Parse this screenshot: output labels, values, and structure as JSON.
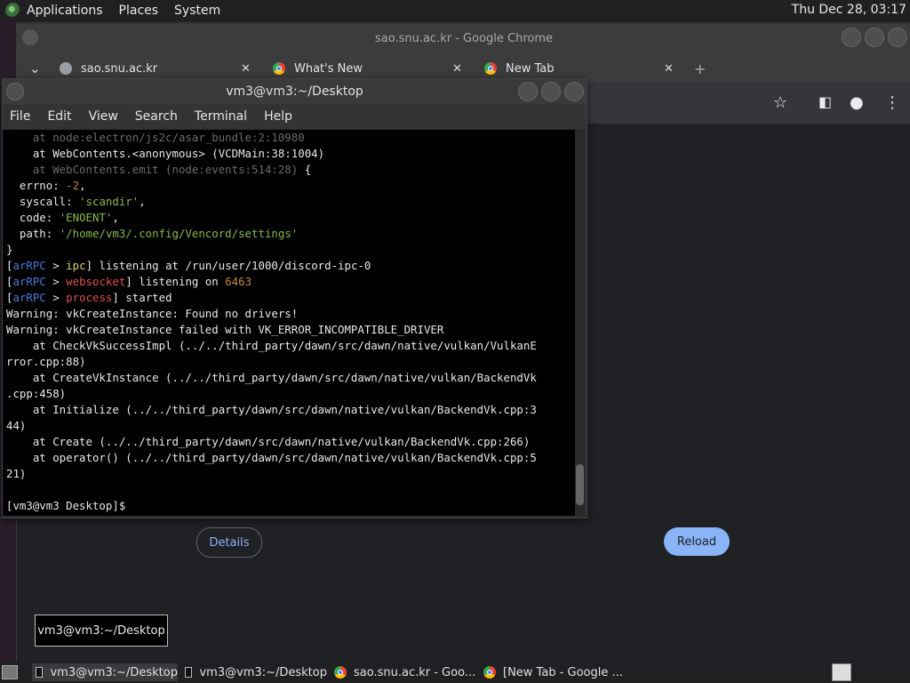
{
  "top_panel": {
    "menus": [
      "Applications",
      "Places",
      "System"
    ],
    "clock": "Thu Dec 28, 03:17"
  },
  "chrome": {
    "title": "sao.snu.ac.kr - Google Chrome",
    "tabs": [
      {
        "label": "sao.snu.ac.kr",
        "icon": "globe-icon"
      },
      {
        "label": "What's New",
        "icon": "chrome-icon"
      },
      {
        "label": "New Tab",
        "icon": "chrome-icon"
      }
    ],
    "close_glyph": "✕",
    "new_tab_glyph": "+",
    "tab_list_glyph": "⌄",
    "buttons": {
      "details": "Details",
      "reload": "Reload"
    }
  },
  "terminal": {
    "title": "vm3@vm3:~/Desktop",
    "menus": [
      "File",
      "Edit",
      "View",
      "Search",
      "Terminal",
      "Help"
    ],
    "lines": [
      [
        {
          "t": "    at node:electron/js2c/asar_bundle:2:10980",
          "c": "dim"
        }
      ],
      [
        {
          "t": "    at WebContents.<anonymous> (VCDMain:38:1004)",
          "c": ""
        }
      ],
      [
        {
          "t": "    at WebContents.emit (node:events:514:28)",
          "c": "dim"
        },
        {
          "t": " {",
          "c": ""
        }
      ],
      [
        {
          "t": "  errno: ",
          "c": ""
        },
        {
          "t": "-2",
          "c": "orn"
        },
        {
          "t": ",",
          "c": ""
        }
      ],
      [
        {
          "t": "  syscall: ",
          "c": ""
        },
        {
          "t": "'scandir'",
          "c": "grn"
        },
        {
          "t": ",",
          "c": ""
        }
      ],
      [
        {
          "t": "  code: ",
          "c": ""
        },
        {
          "t": "'ENOENT'",
          "c": "grn"
        },
        {
          "t": ",",
          "c": ""
        }
      ],
      [
        {
          "t": "  path: ",
          "c": ""
        },
        {
          "t": "'/home/vm3/.config/Vencord/settings'",
          "c": "grn"
        }
      ],
      [
        {
          "t": "}",
          "c": ""
        }
      ],
      [
        {
          "t": "[",
          "c": ""
        },
        {
          "t": "arRPC",
          "c": "blue"
        },
        {
          "t": " > ",
          "c": ""
        },
        {
          "t": "ipc",
          "c": "yel"
        },
        {
          "t": "] listening at /run/user/1000/discord-ipc-0",
          "c": ""
        }
      ],
      [
        {
          "t": "[",
          "c": ""
        },
        {
          "t": "arRPC",
          "c": "blue"
        },
        {
          "t": " > ",
          "c": ""
        },
        {
          "t": "websocket",
          "c": "red"
        },
        {
          "t": "] listening on ",
          "c": ""
        },
        {
          "t": "6463",
          "c": "orn"
        }
      ],
      [
        {
          "t": "[",
          "c": ""
        },
        {
          "t": "arRPC",
          "c": "blue"
        },
        {
          "t": " > ",
          "c": ""
        },
        {
          "t": "process",
          "c": "red"
        },
        {
          "t": "] started",
          "c": ""
        }
      ],
      [
        {
          "t": "Warning: vkCreateInstance: Found no drivers!",
          "c": ""
        }
      ],
      [
        {
          "t": "Warning: vkCreateInstance failed with VK_ERROR_INCOMPATIBLE_DRIVER",
          "c": ""
        }
      ],
      [
        {
          "t": "    at CheckVkSuccessImpl (../../third_party/dawn/src/dawn/native/vulkan/VulkanE",
          "c": ""
        }
      ],
      [
        {
          "t": "rror.cpp:88)",
          "c": ""
        }
      ],
      [
        {
          "t": "    at CreateVkInstance (../../third_party/dawn/src/dawn/native/vulkan/BackendVk",
          "c": ""
        }
      ],
      [
        {
          "t": ".cpp:458)",
          "c": ""
        }
      ],
      [
        {
          "t": "    at Initialize (../../third_party/dawn/src/dawn/native/vulkan/BackendVk.cpp:3",
          "c": ""
        }
      ],
      [
        {
          "t": "44)",
          "c": ""
        }
      ],
      [
        {
          "t": "    at Create (../../third_party/dawn/src/dawn/native/vulkan/BackendVk.cpp:266)",
          "c": ""
        }
      ],
      [
        {
          "t": "    at operator() (../../third_party/dawn/src/dawn/native/vulkan/BackendVk.cpp:5",
          "c": ""
        }
      ],
      [
        {
          "t": "21)",
          "c": ""
        }
      ],
      [
        {
          "t": "",
          "c": ""
        }
      ],
      [
        {
          "t": "[vm3@vm3 Desktop]$ ",
          "c": ""
        }
      ]
    ]
  },
  "tooltip": "vm3@vm3:~/Desktop",
  "taskbar": {
    "tasks": [
      {
        "label": "vm3@vm3:~/Desktop",
        "icon": "terminal-icon"
      },
      {
        "label": "vm3@vm3:~/Desktop",
        "icon": "terminal-icon"
      },
      {
        "label": "sao.snu.ac.kr - Goo...",
        "icon": "chrome-icon"
      },
      {
        "label": "[New Tab - Google ...",
        "icon": "chrome-icon"
      }
    ]
  }
}
